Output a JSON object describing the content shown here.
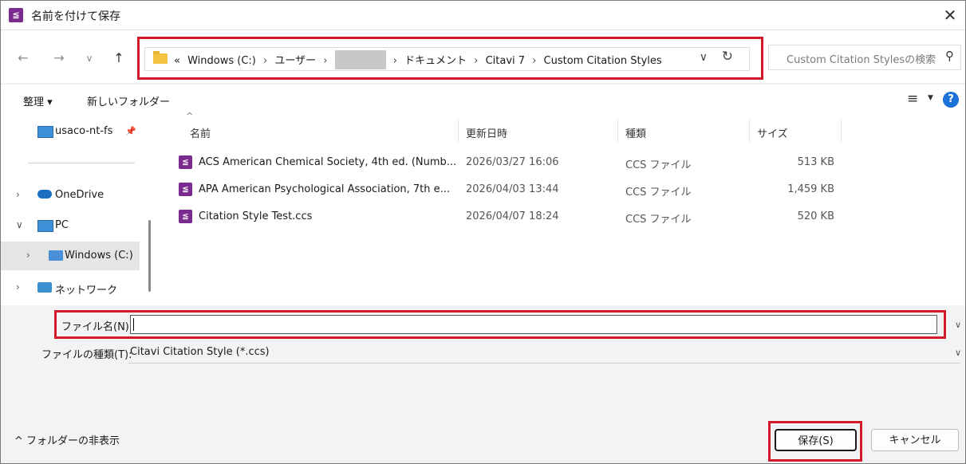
{
  "window": {
    "title": "名前を付けて保存",
    "close_glyph": "✕"
  },
  "nav": {
    "back": "←",
    "forward": "→",
    "recent": "∨",
    "up": "↑",
    "breadcrumb": {
      "prefix": "«",
      "items": [
        "Windows (C:)",
        "ユーザー",
        "",
        "ドキュメント",
        "Citavi 7",
        "Custom Citation Styles"
      ],
      "separator": "›"
    },
    "dropdown_glyph": "∨",
    "refresh_glyph": "↻",
    "search_placeholder": "Custom Citation Stylesの検索"
  },
  "toolbar": {
    "organize": "整理 ▾",
    "new_folder": "新しいフォルダー",
    "help": "?"
  },
  "navpane": {
    "items": [
      {
        "label": "usaco-nt-fs",
        "chevron": "",
        "icon": "monitor-icon"
      },
      {
        "label": "OneDrive",
        "chevron": "›",
        "icon": "cloud-icon"
      },
      {
        "label": "PC",
        "chevron": "∨",
        "icon": "monitor-icon"
      },
      {
        "label": "Windows (C:)",
        "chevron": "›",
        "icon": "drive-icon"
      },
      {
        "label": "ネットワーク",
        "chevron": "›",
        "icon": "network-icon"
      }
    ]
  },
  "filelist": {
    "columns": {
      "name": "名前",
      "date": "更新日時",
      "type": "種類",
      "size": "サイズ"
    },
    "rows": [
      {
        "name": "ACS American Chemical Society, 4th ed. (Numb...",
        "date": "2026/03/27 16:06",
        "type": "CCS ファイル",
        "size": "513 KB"
      },
      {
        "name": "APA American Psychological Association, 7th e...",
        "date": "2026/04/03 13:44",
        "type": "CCS ファイル",
        "size": "1,459 KB"
      },
      {
        "name": "Citation Style Test.ccs",
        "date": "2026/04/07 18:24",
        "type": "CCS ファイル",
        "size": "520 KB"
      }
    ]
  },
  "fields": {
    "filename_label": "ファイル名(N):",
    "filename_value": "",
    "filetype_label": "ファイルの種類(T):",
    "filetype_value": "Citavi Citation Style (*.ccs)"
  },
  "footer": {
    "hide_folders": "^ フォルダーの非表示",
    "save": "保存(S)",
    "cancel": "キャンセル"
  },
  "colors": {
    "highlight": "#d11a2a",
    "accent": "#1e73d8",
    "citavi": "#7b2a8f"
  }
}
